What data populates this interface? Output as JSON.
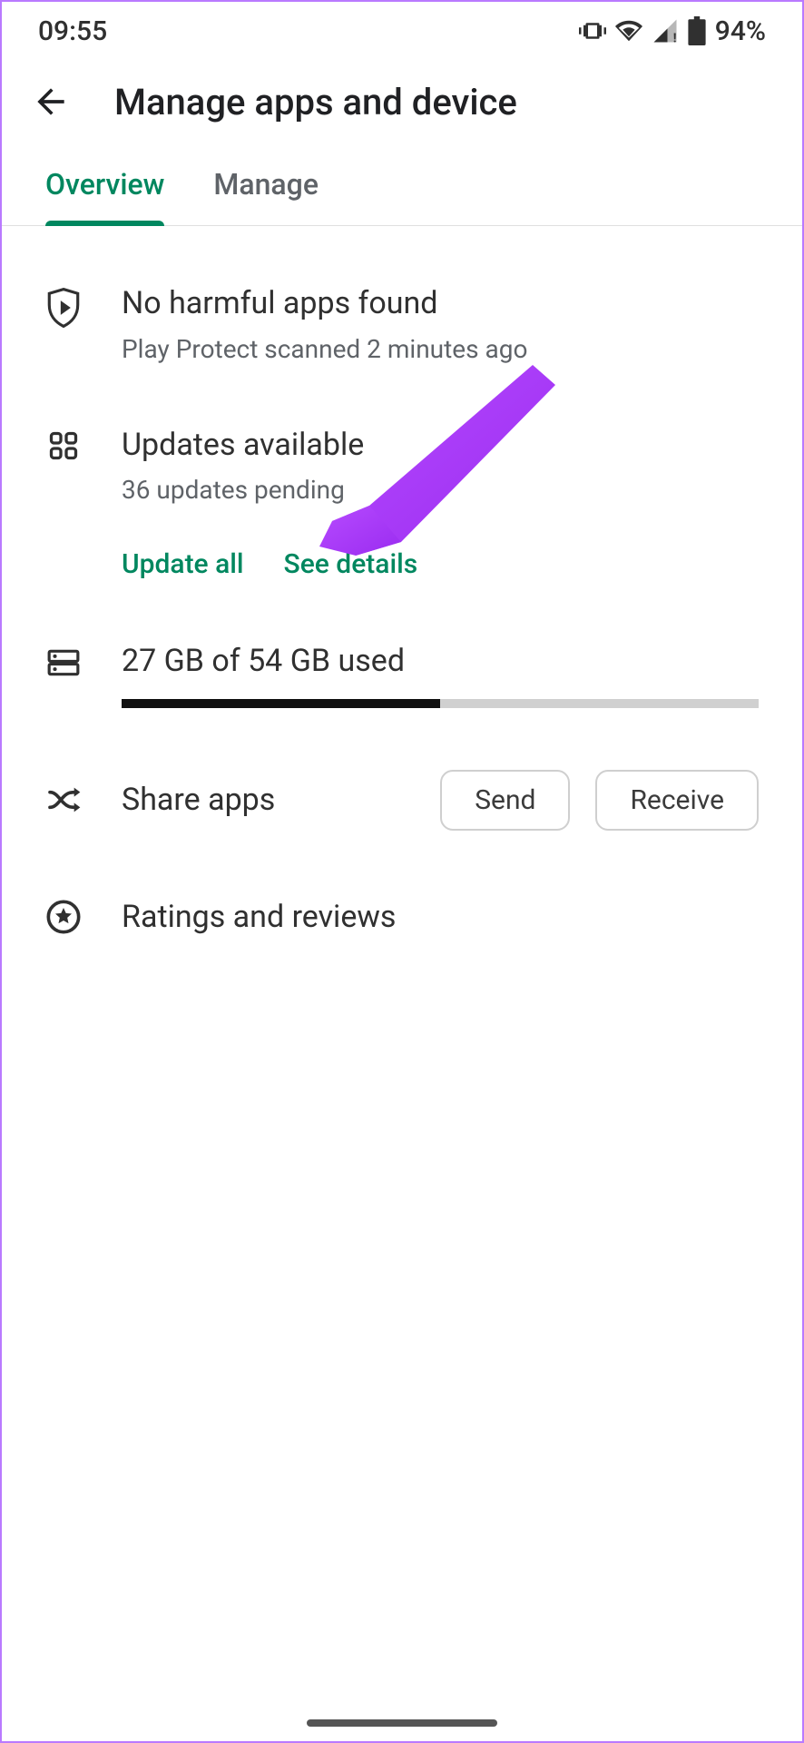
{
  "status": {
    "time": "09:55",
    "battery_pct": "94%"
  },
  "header": {
    "title": "Manage apps and device"
  },
  "tabs": {
    "overview": "Overview",
    "manage": "Manage"
  },
  "protect": {
    "title": "No harmful apps found",
    "subtitle": "Play Protect scanned 2 minutes ago"
  },
  "updates": {
    "title": "Updates available",
    "subtitle": "36 updates pending",
    "update_all": "Update all",
    "see_details": "See details"
  },
  "storage": {
    "label": "27 GB of 54 GB used",
    "used_gb": 27,
    "total_gb": 54,
    "percent": 50
  },
  "share": {
    "title": "Share apps",
    "send": "Send",
    "receive": "Receive"
  },
  "ratings": {
    "title": "Ratings and reviews"
  }
}
